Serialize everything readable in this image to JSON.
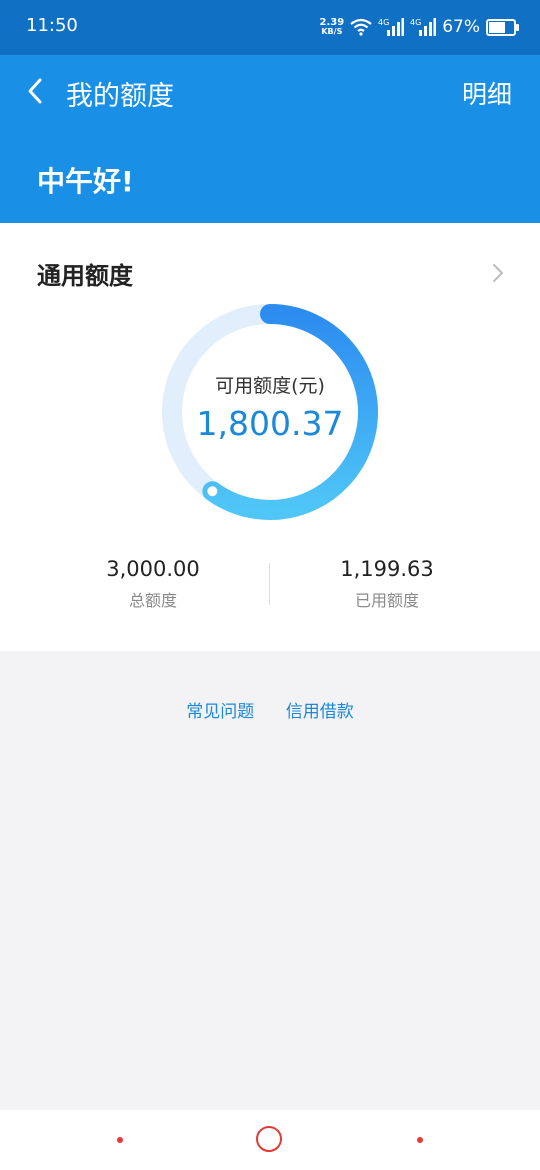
{
  "status_bar": {
    "time": "11:50",
    "net_speed": "2.39",
    "net_speed_unit": "KB/S",
    "signal_1": "4G",
    "signal_2": "4G",
    "battery_percent": "67%",
    "battery_level": 0.67
  },
  "header": {
    "title": "我的额度",
    "detail_label": "明细",
    "greeting": "中午好!"
  },
  "credit_card": {
    "title": "通用额度",
    "available_label": "可用额度(元)",
    "available_amount": "1,800.37",
    "available_fraction": 0.6001,
    "total_amount": "3,000.00",
    "total_label": "总额度",
    "used_amount": "1,199.63",
    "used_label": "已用额度",
    "ring_color_start": "#2d8cf0",
    "ring_color_end": "#4fc6f7",
    "ring_track_color": "#e1eefb"
  },
  "links": {
    "faq": "常见问题",
    "credit_loan": "信用借款"
  },
  "colors": {
    "status_bar": "#1070c4",
    "app_bar": "#1a8fe6",
    "accent": "#1b88d8",
    "nav_accent": "#e53935"
  },
  "icons": [
    "back-arrow-icon",
    "chevron-right-icon",
    "wifi-icon",
    "signal-icon",
    "battery-icon"
  ]
}
